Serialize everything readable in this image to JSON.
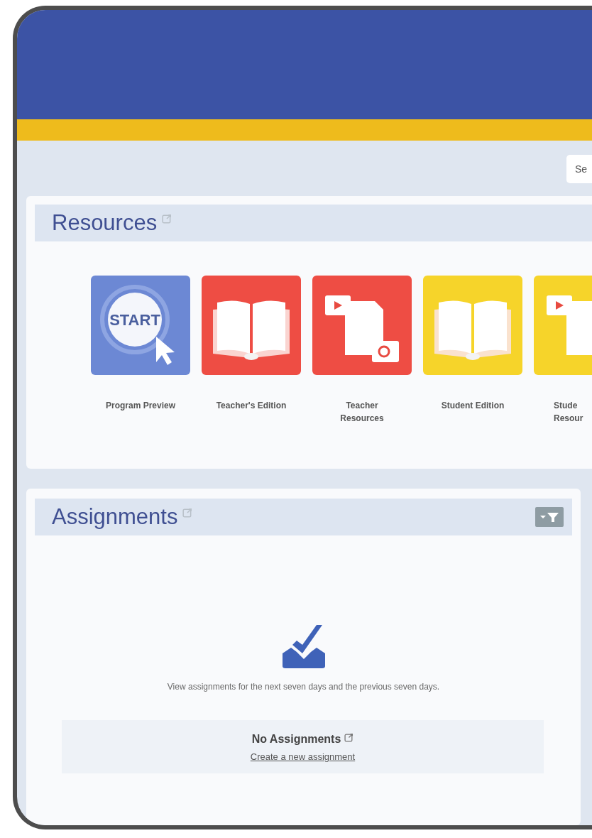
{
  "search": {
    "placeholder": "Se"
  },
  "resources": {
    "title": "Resources",
    "tiles": [
      {
        "kind": "start",
        "color": "#6c88d4",
        "badge": "START",
        "lines": [
          "Program Preview"
        ]
      },
      {
        "kind": "book",
        "color": "#ee4d44",
        "lines": [
          "Teacher's Edition"
        ]
      },
      {
        "kind": "media",
        "color": "#ee4d44",
        "lines": [
          "Teacher",
          "Resources"
        ]
      },
      {
        "kind": "book",
        "color": "#f6d42a",
        "lines": [
          "Student Edition"
        ]
      },
      {
        "kind": "media",
        "color": "#f6d42a",
        "lines": [
          "Stude",
          "Resour"
        ]
      }
    ]
  },
  "assignments": {
    "title": "Assignments",
    "message": "View assignments for the next seven days and the previous seven days.",
    "empty_title": "No Assignments",
    "create_link": "Create a new assignment"
  }
}
